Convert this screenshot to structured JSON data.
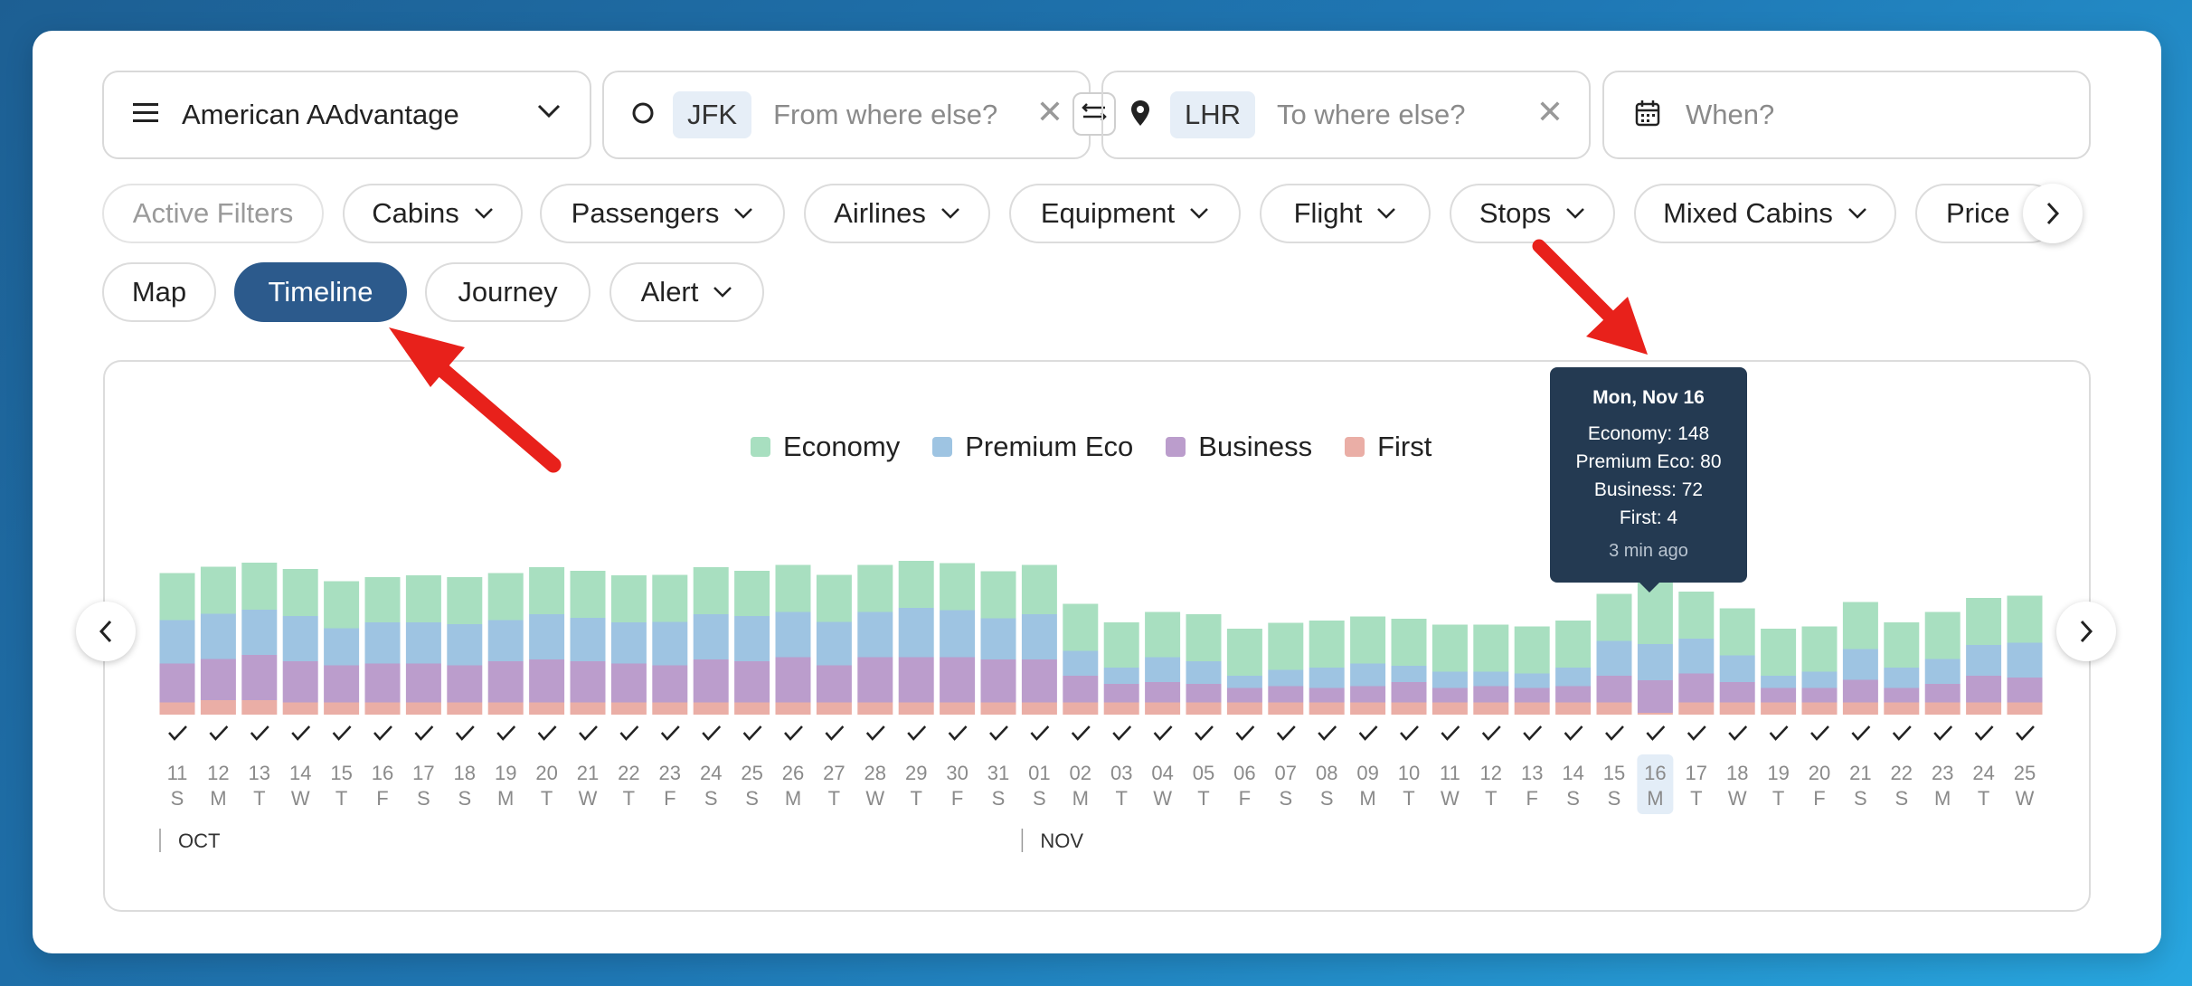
{
  "search": {
    "program": "American AAdvantage",
    "origin_code": "JFK",
    "origin_placeholder": "From where else?",
    "destination_code": "LHR",
    "destination_placeholder": "To where else?",
    "date_placeholder": "When?"
  },
  "filters": [
    "Active Filters",
    "Cabins",
    "Passengers",
    "Airlines",
    "Equipment",
    "Flight",
    "Stops",
    "Mixed Cabins",
    "Price"
  ],
  "views": [
    "Map",
    "Timeline",
    "Journey",
    "Alert"
  ],
  "legend": [
    "Economy",
    "Premium Eco",
    "Business",
    "First"
  ],
  "colors": {
    "economy": "#a8dfc0",
    "premium": "#9ec4e2",
    "business": "#bb9dcc",
    "first": "#eaaea6",
    "accent": "#2c5a8c"
  },
  "tooltip": {
    "title": "Mon, Nov 16",
    "lines": [
      "Economy: 148",
      "Premium Eco: 80",
      "Business: 72",
      "First: 4"
    ],
    "footer": "3 min ago"
  },
  "chart_data": {
    "type": "bar",
    "stacked": true,
    "months": [
      "OCT",
      "NOV"
    ],
    "days": [
      "11",
      "12",
      "13",
      "14",
      "15",
      "16",
      "17",
      "18",
      "19",
      "20",
      "21",
      "22",
      "23",
      "24",
      "25",
      "26",
      "27",
      "28",
      "29",
      "30",
      "31",
      "01",
      "02",
      "03",
      "04",
      "05",
      "06",
      "07",
      "08",
      "09",
      "10",
      "11",
      "12",
      "13",
      "14",
      "15",
      "16",
      "17",
      "18",
      "19",
      "20",
      "21",
      "22",
      "23",
      "24",
      "25"
    ],
    "weekdays": [
      "S",
      "M",
      "T",
      "W",
      "T",
      "F",
      "S",
      "S",
      "M",
      "T",
      "W",
      "T",
      "F",
      "S",
      "S",
      "M",
      "T",
      "W",
      "T",
      "F",
      "S",
      "S",
      "M",
      "T",
      "W",
      "T",
      "F",
      "S",
      "S",
      "M",
      "T",
      "W",
      "T",
      "F",
      "S",
      "S",
      "M",
      "T",
      "W",
      "T",
      "F",
      "S",
      "S",
      "M",
      "T",
      "W"
    ],
    "selected_index": 36,
    "series": [
      {
        "name": "Economy",
        "values": [
          104,
          104,
          104,
          104,
          104,
          100,
          104,
          104,
          104,
          104,
          104,
          104,
          104,
          104,
          100,
          104,
          104,
          104,
          104,
          104,
          104,
          109,
          104,
          100,
          100,
          104,
          104,
          104,
          104,
          104,
          104,
          104,
          104,
          104,
          104,
          104,
          148,
          104,
          104,
          104,
          100,
          104,
          100,
          104,
          104,
          104
        ]
      },
      {
        "name": "Premium Eco",
        "values": [
          96,
          100,
          100,
          100,
          82,
          91,
          91,
          91,
          91,
          100,
          96,
          91,
          96,
          100,
          100,
          100,
          96,
          100,
          109,
          104,
          91,
          100,
          55,
          36,
          55,
          50,
          27,
          36,
          45,
          50,
          36,
          36,
          32,
          32,
          41,
          77,
          80,
          77,
          59,
          27,
          36,
          68,
          45,
          55,
          68,
          77
        ]
      },
      {
        "name": "Business",
        "values": [
          86,
          91,
          100,
          91,
          82,
          86,
          86,
          82,
          91,
          95,
          91,
          86,
          82,
          95,
          91,
          100,
          82,
          100,
          100,
          100,
          95,
          95,
          59,
          41,
          45,
          41,
          32,
          36,
          32,
          36,
          45,
          32,
          36,
          32,
          36,
          59,
          72,
          64,
          45,
          32,
          32,
          50,
          32,
          41,
          59,
          55
        ]
      },
      {
        "name": "First",
        "values": [
          27,
          32,
          32,
          27,
          27,
          27,
          27,
          27,
          27,
          27,
          27,
          27,
          27,
          27,
          27,
          27,
          27,
          27,
          27,
          27,
          27,
          27,
          27,
          27,
          27,
          27,
          27,
          27,
          27,
          27,
          27,
          27,
          27,
          27,
          27,
          27,
          4,
          27,
          27,
          27,
          27,
          27,
          27,
          27,
          27,
          27
        ]
      }
    ]
  }
}
